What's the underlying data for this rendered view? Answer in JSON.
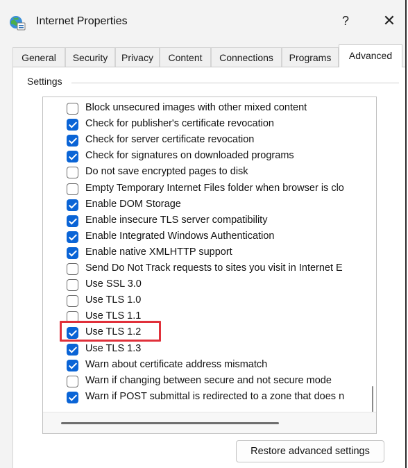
{
  "window": {
    "title": "Internet Properties",
    "help_glyph": "?",
    "close_glyph": "✕"
  },
  "tabs": [
    {
      "label": "General"
    },
    {
      "label": "Security"
    },
    {
      "label": "Privacy"
    },
    {
      "label": "Content"
    },
    {
      "label": "Connections"
    },
    {
      "label": "Programs"
    },
    {
      "label": "Advanced",
      "active": true
    }
  ],
  "settings": {
    "group_label": "Settings",
    "items": [
      {
        "label": "Block unsecured images with other mixed content",
        "checked": false
      },
      {
        "label": "Check for publisher's certificate revocation",
        "checked": true
      },
      {
        "label": "Check for server certificate revocation",
        "checked": true
      },
      {
        "label": "Check for signatures on downloaded programs",
        "checked": true
      },
      {
        "label": "Do not save encrypted pages to disk",
        "checked": false
      },
      {
        "label": "Empty Temporary Internet Files folder when browser is clo",
        "checked": false
      },
      {
        "label": "Enable DOM Storage",
        "checked": true
      },
      {
        "label": "Enable insecure TLS server compatibility",
        "checked": true
      },
      {
        "label": "Enable Integrated Windows Authentication",
        "checked": true
      },
      {
        "label": "Enable native XMLHTTP support",
        "checked": true
      },
      {
        "label": "Send Do Not Track requests to sites you visit in Internet E",
        "checked": false
      },
      {
        "label": "Use SSL 3.0",
        "checked": false
      },
      {
        "label": "Use TLS 1.0",
        "checked": false
      },
      {
        "label": "Use TLS 1.1",
        "checked": false
      },
      {
        "label": "Use TLS 1.2",
        "checked": true,
        "highlighted": true
      },
      {
        "label": "Use TLS 1.3",
        "checked": true
      },
      {
        "label": "Warn about certificate address mismatch",
        "checked": true
      },
      {
        "label": "Warn if changing between secure and not secure mode",
        "checked": false
      },
      {
        "label": "Warn if POST submittal is redirected to a zone that does n",
        "checked": true
      }
    ]
  },
  "buttons": {
    "restore_label": "Restore advanced settings"
  },
  "colors": {
    "accent": "#0a64d6",
    "highlight": "#e0303a"
  }
}
